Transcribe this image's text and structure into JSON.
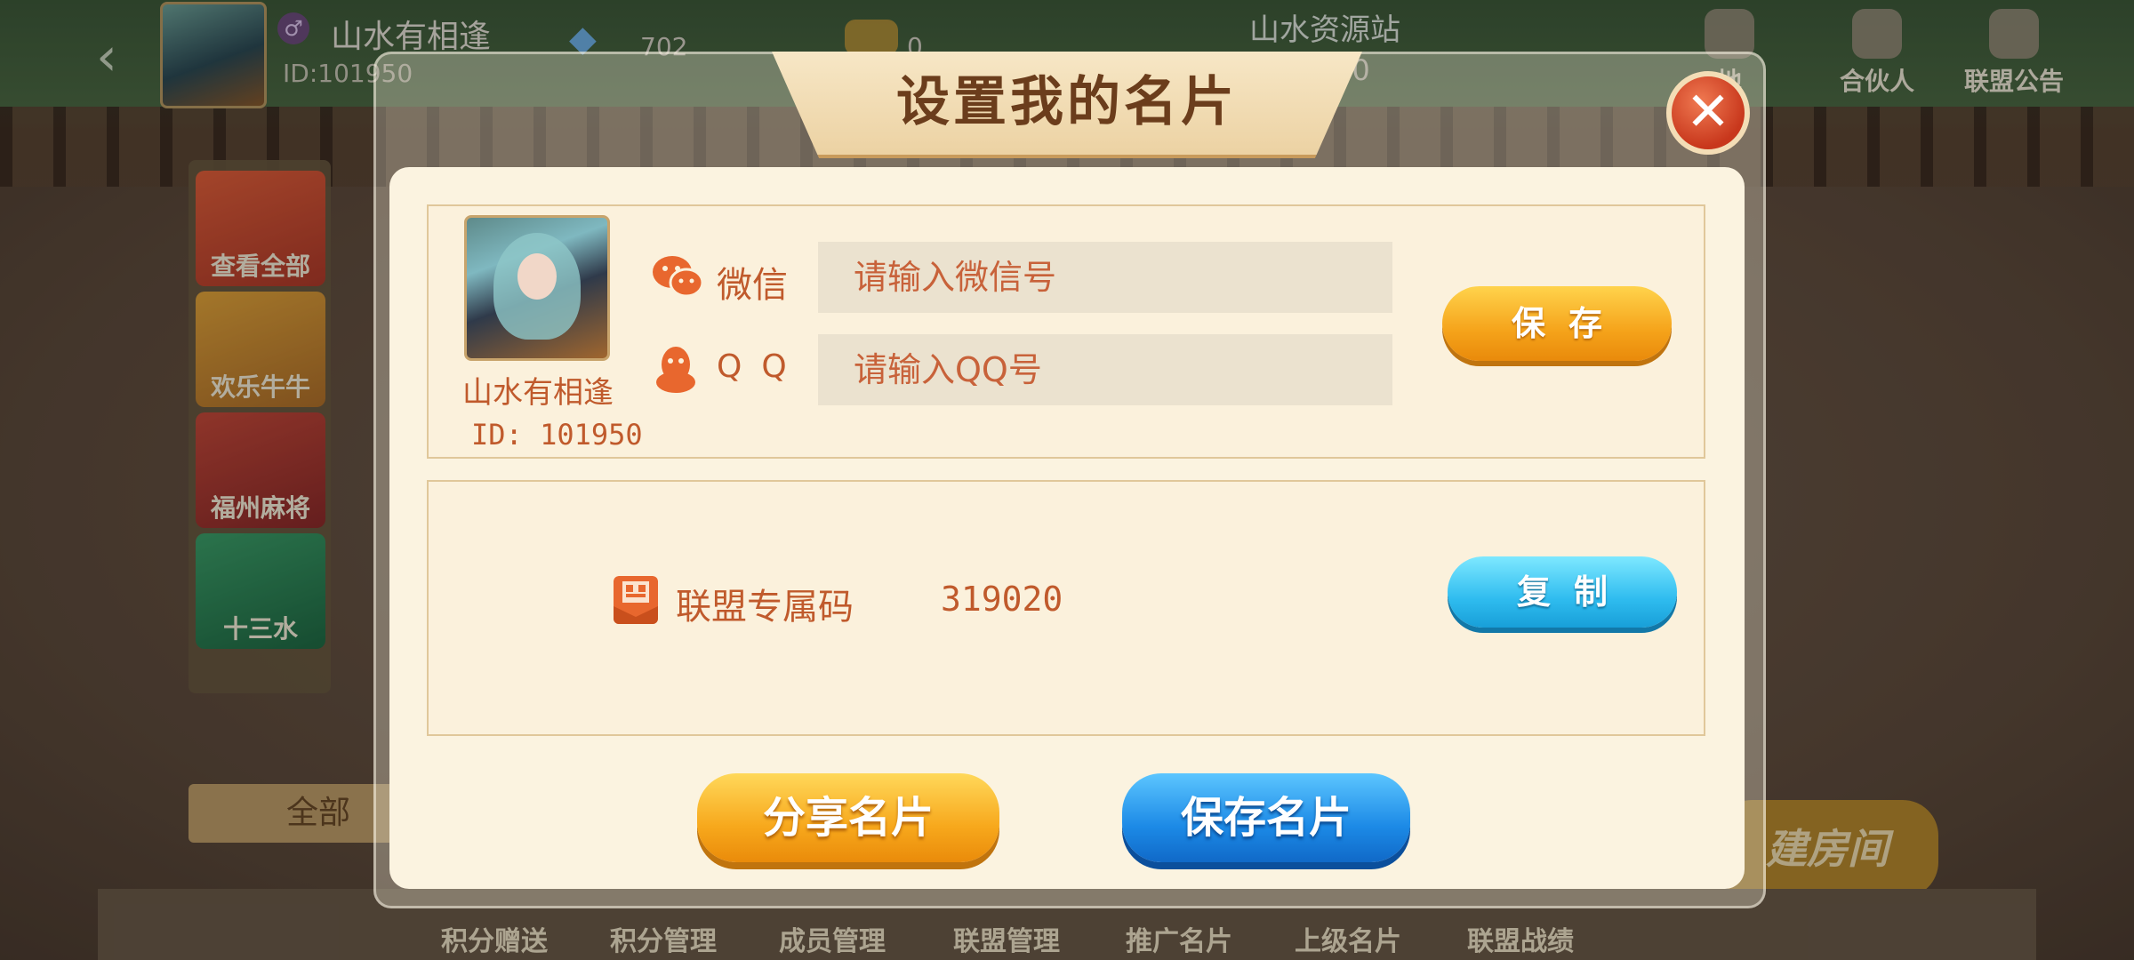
{
  "header": {
    "user_name": "山水有相逢",
    "user_id": "ID:101950",
    "gem_count": "702",
    "gold_count": "0",
    "site_title": "山水资源站",
    "site_number": "20",
    "buttons": [
      {
        "label": "地",
        "icon": "map-icon"
      },
      {
        "label": "合伙人",
        "icon": "handshake-icon"
      },
      {
        "label": "联盟公告",
        "icon": "speaker-icon"
      }
    ]
  },
  "sidebar": {
    "games": [
      "查看全部",
      "欢乐牛牛",
      "福州麻将",
      "十三水"
    ]
  },
  "lobby": {
    "all_tab": "全部",
    "create_room": "建房间",
    "bottom_nav": [
      "积分赠送",
      "积分管理",
      "成员管理",
      "联盟管理",
      "推广名片",
      "上级名片",
      "联盟战绩"
    ]
  },
  "modal": {
    "title": "设置我的名片",
    "close_icon": "close-icon",
    "profile": {
      "name": "山水有相逢",
      "id": "ID: 101950"
    },
    "wechat": {
      "label": "微信",
      "placeholder": "请输入微信号",
      "value": ""
    },
    "qq": {
      "label": "QQ",
      "placeholder": "请输入QQ号",
      "value": ""
    },
    "save_label": "保存",
    "alliance_code": {
      "label": "联盟专属码",
      "value": "319020"
    },
    "copy_label": "复制",
    "share_card_label": "分享名片",
    "save_card_label": "保存名片"
  },
  "colors": {
    "text_accent": "#c05a2c",
    "orange_button": "#f5a31a",
    "cyan_button": "#2fbcef",
    "blue_button": "#1c8ae6",
    "close_red": "#c8371c"
  }
}
